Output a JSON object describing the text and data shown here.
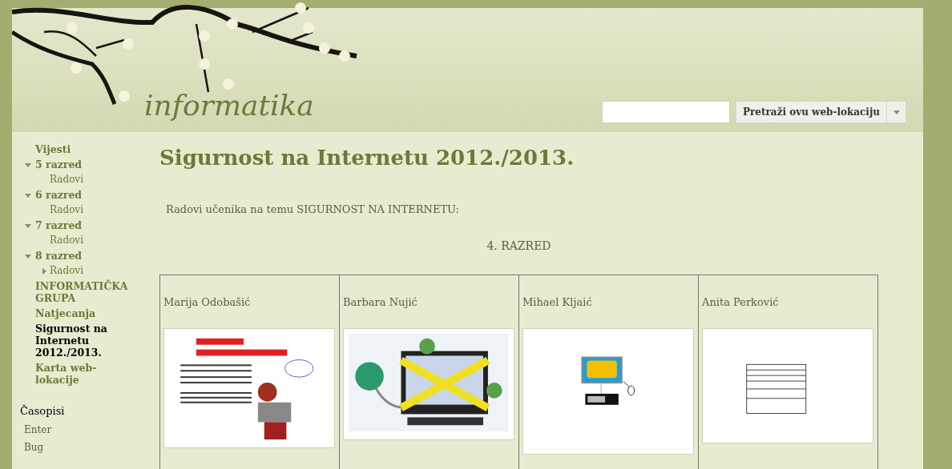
{
  "site": {
    "title": "informatika"
  },
  "search": {
    "button": "Pretraži ovu web-lokaciju"
  },
  "nav": [
    {
      "label": "Vijesti",
      "selected": false
    },
    {
      "label": "5 razred",
      "selected": false,
      "expanded": true,
      "children": [
        {
          "label": "Radovi"
        }
      ]
    },
    {
      "label": "6 razred",
      "selected": false,
      "expanded": true,
      "children": [
        {
          "label": "Radovi"
        }
      ]
    },
    {
      "label": "7 razred",
      "selected": false,
      "expanded": true,
      "children": [
        {
          "label": "Radovi"
        }
      ]
    },
    {
      "label": "8 razred",
      "selected": false,
      "expanded": true,
      "children": [
        {
          "label": "Radovi",
          "expanded": false
        }
      ]
    },
    {
      "label": "INFORMATIČKA GRUPA",
      "selected": false
    },
    {
      "label": "Natjecanja",
      "selected": false
    },
    {
      "label": "Sigurnost na Internetu 2012./2013.",
      "selected": true
    },
    {
      "label": "Karta web-lokacije",
      "selected": false
    }
  ],
  "magazines": {
    "heading": "Časopisi",
    "items": [
      "Enter",
      "Bug"
    ]
  },
  "page": {
    "title": "Sigurnost na Internetu 2012./2013.",
    "intro": "Radovi učenika na temu SIGURNOST NA INTERNETU:",
    "section": "4. RAZRED"
  },
  "works": [
    {
      "author": "Marija Odobašić",
      "kind": "poster"
    },
    {
      "author": "Barbara Nujić",
      "kind": "computer"
    },
    {
      "author": "Mihael Kljaić",
      "kind": "sketch"
    },
    {
      "author": "Anita Perković",
      "kind": "form"
    }
  ]
}
